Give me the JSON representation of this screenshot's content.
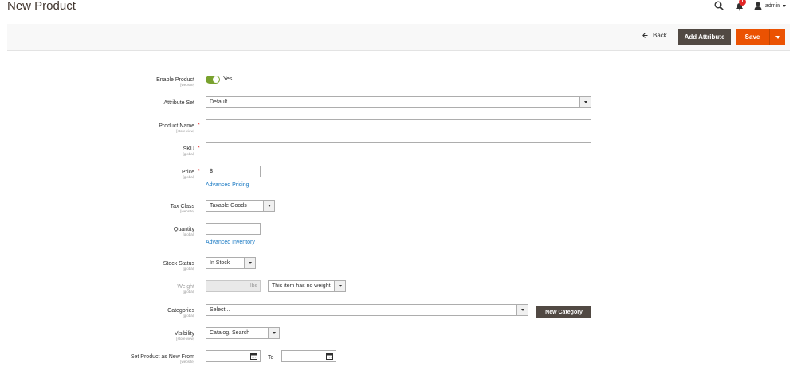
{
  "header": {
    "title": "New Product",
    "notifications_count": "1",
    "user_label": "admin"
  },
  "actions": {
    "back_label": "Back",
    "add_attribute_label": "Add Attribute",
    "save_label": "Save"
  },
  "form": {
    "enable_product": {
      "label": "Enable Product",
      "scope": "[website]",
      "value": "Yes"
    },
    "attribute_set": {
      "label": "Attribute Set",
      "value": "Default"
    },
    "product_name": {
      "label": "Product Name",
      "scope": "[store view]",
      "value": ""
    },
    "sku": {
      "label": "SKU",
      "scope": "[global]",
      "value": ""
    },
    "price": {
      "label": "Price",
      "scope": "[global]",
      "prefix": "$",
      "link": "Advanced Pricing"
    },
    "tax_class": {
      "label": "Tax Class",
      "scope": "[website]",
      "value": "Taxable Goods"
    },
    "quantity": {
      "label": "Quantity",
      "scope": "[global]",
      "value": "",
      "link": "Advanced Inventory"
    },
    "stock_status": {
      "label": "Stock Status",
      "scope": "[global]",
      "value": "In Stock"
    },
    "weight": {
      "label": "Weight",
      "scope": "[global]",
      "unit": "lbs",
      "type_value": "This item has no weight"
    },
    "categories": {
      "label": "Categories",
      "scope": "[global]",
      "placeholder": "Select...",
      "button": "New Category"
    },
    "visibility": {
      "label": "Visibility",
      "scope": "[store view]",
      "value": "Catalog, Search"
    },
    "new_from": {
      "label": "Set Product as New From",
      "scope": "[website]",
      "to_label": "To"
    }
  },
  "colors": {
    "accent": "#eb5202",
    "dark_button": "#514943",
    "toggle_on": "#79a22e",
    "link": "#1979c3"
  }
}
